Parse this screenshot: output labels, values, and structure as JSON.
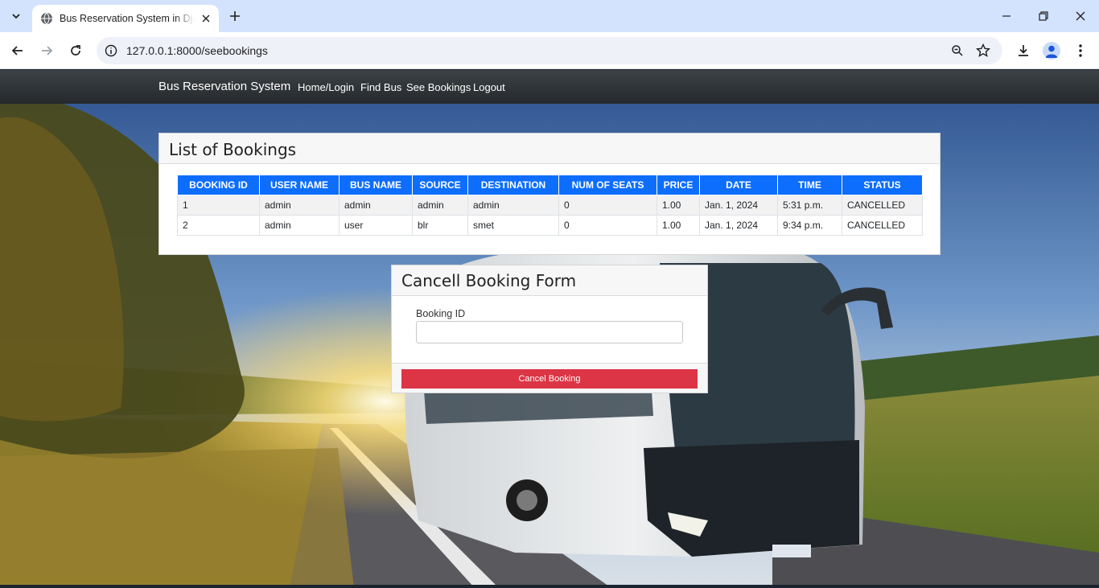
{
  "browser": {
    "tab_title": "Bus Reservation System in Django",
    "url": "127.0.0.1:8000/seebookings"
  },
  "site": {
    "brand": "Bus Reservation System",
    "nav": [
      "Home/Login",
      "Find Bus",
      "See Bookings",
      "Logout"
    ]
  },
  "bookings": {
    "title": "List of Bookings",
    "columns": [
      "BOOKING ID",
      "USER NAME",
      "BUS NAME",
      "SOURCE",
      "DESTINATION",
      "NUM OF SEATS",
      "PRICE",
      "DATE",
      "TIME",
      "STATUS"
    ],
    "rows": [
      [
        "1",
        "admin",
        "admin",
        "admin",
        "admin",
        "0",
        "1.00",
        "Jan. 1, 2024",
        "5:31 p.m.",
        "CANCELLED"
      ],
      [
        "2",
        "admin",
        "user",
        "blr",
        "smet",
        "0",
        "1.00",
        "Jan. 1, 2024",
        "9:34 p.m.",
        "CANCELLED"
      ]
    ]
  },
  "cancel_form": {
    "title": "Cancell Booking Form",
    "field_label": "Booking ID",
    "field_value": "",
    "button_label": "Cancel Booking"
  },
  "colors": {
    "primary": "#0d6efd",
    "danger": "#dc3545",
    "nav_bg": "#343a40",
    "chrome_tabstrip": "#d3e3fd"
  }
}
